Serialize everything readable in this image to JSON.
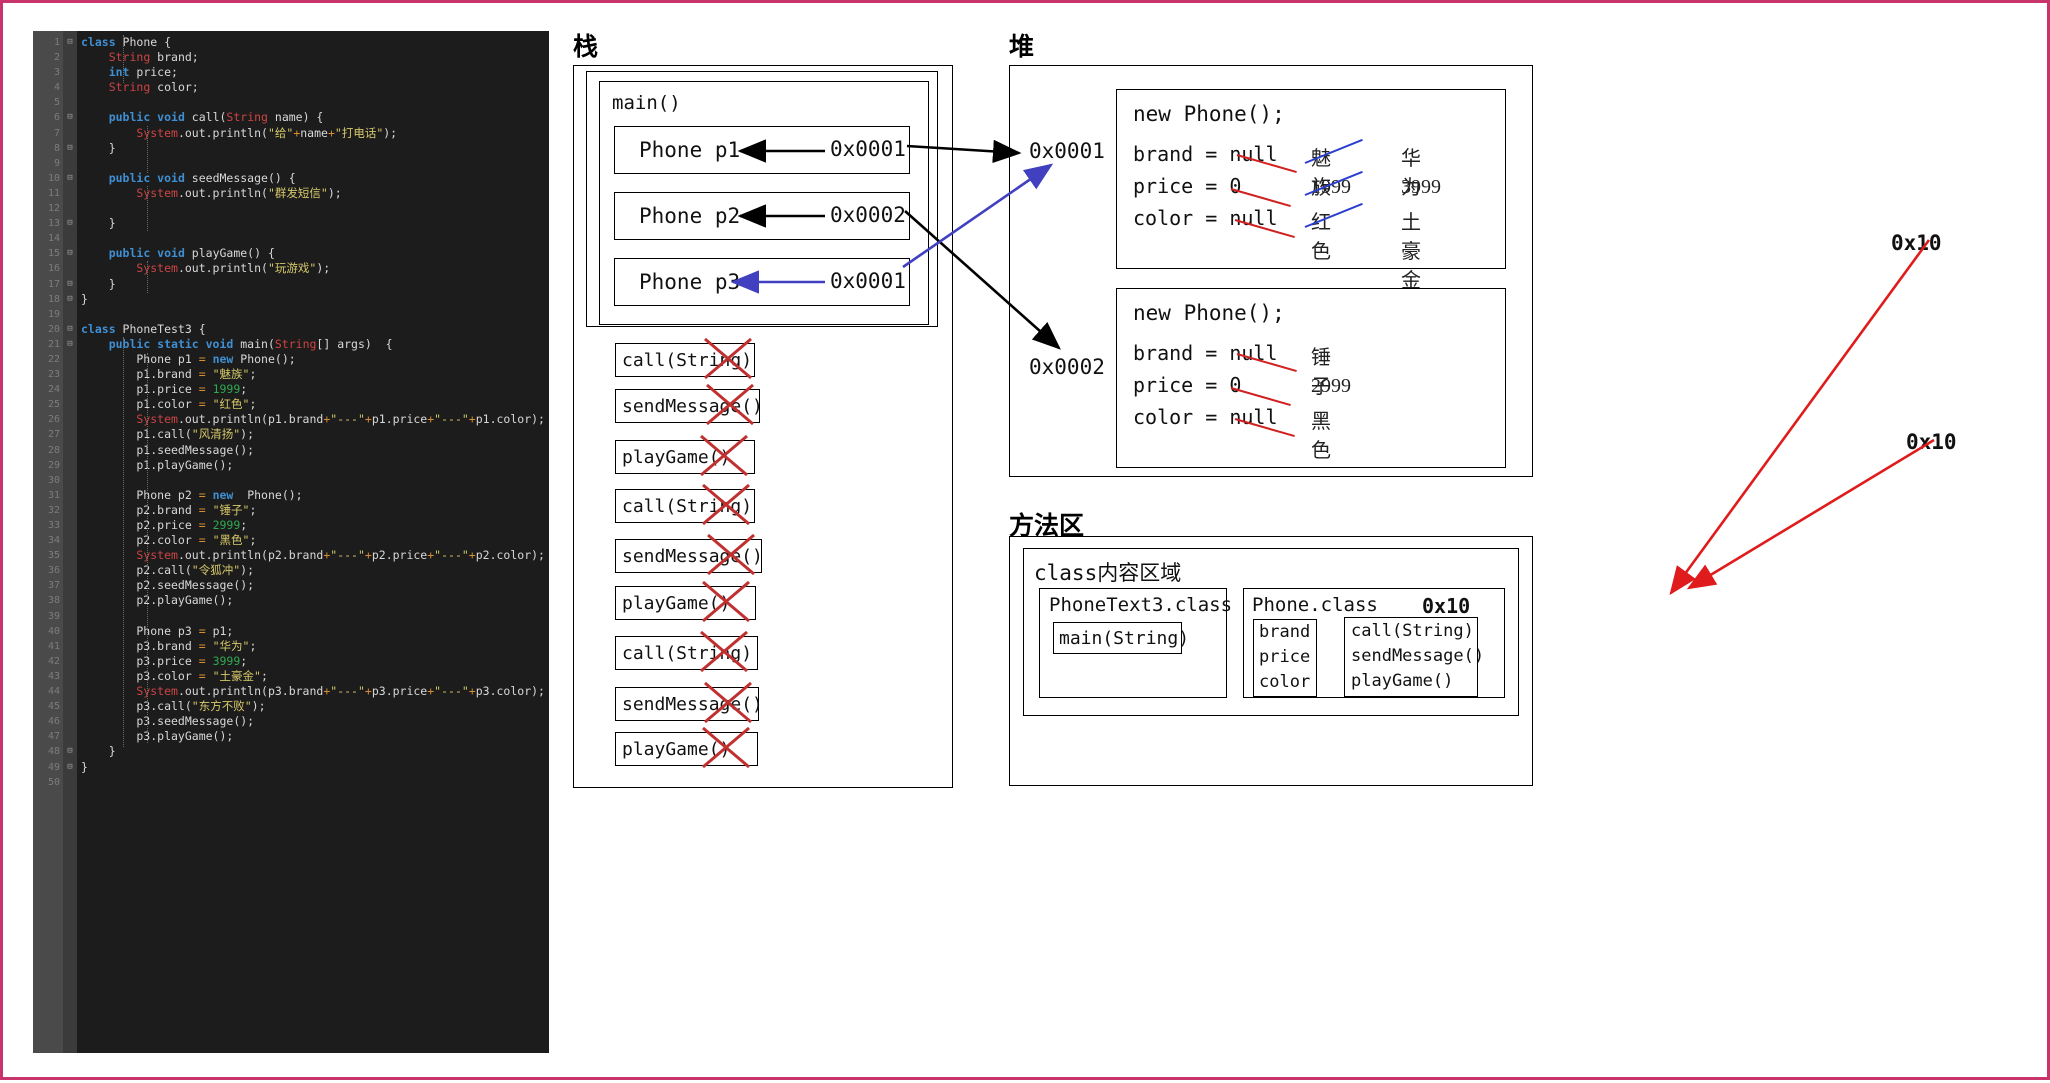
{
  "editor": {
    "name": "java-code-editor",
    "language": "Java",
    "total_lines": 50,
    "lines": [
      {
        "n": 1,
        "fold": "-",
        "tokens": [
          {
            "t": "class ",
            "c": "kw"
          },
          {
            "t": "Phone {",
            "c": "pl"
          }
        ]
      },
      {
        "n": 2,
        "fold": "",
        "tokens": [
          {
            "t": "    ",
            "c": "pl"
          },
          {
            "t": "String",
            "c": "ty"
          },
          {
            "t": " brand;",
            "c": "pl"
          }
        ]
      },
      {
        "n": 3,
        "fold": "",
        "tokens": [
          {
            "t": "    ",
            "c": "pl"
          },
          {
            "t": "int",
            "c": "kw"
          },
          {
            "t": " price;",
            "c": "pl"
          }
        ]
      },
      {
        "n": 4,
        "fold": "",
        "tokens": [
          {
            "t": "    ",
            "c": "pl"
          },
          {
            "t": "String",
            "c": "ty"
          },
          {
            "t": " color;",
            "c": "pl"
          }
        ]
      },
      {
        "n": 5,
        "fold": "",
        "tokens": []
      },
      {
        "n": 6,
        "fold": "-",
        "tokens": [
          {
            "t": "    ",
            "c": "pl"
          },
          {
            "t": "public void",
            "c": "kw"
          },
          {
            "t": " call(",
            "c": "pl"
          },
          {
            "t": "String",
            "c": "ty"
          },
          {
            "t": " name) {",
            "c": "pl"
          }
        ]
      },
      {
        "n": 7,
        "fold": "",
        "tokens": [
          {
            "t": "        ",
            "c": "pl"
          },
          {
            "t": "System",
            "c": "sysred"
          },
          {
            "t": ".out.println(",
            "c": "pl"
          },
          {
            "t": "\"给\"",
            "c": "st"
          },
          {
            "t": "+",
            "c": "op"
          },
          {
            "t": "name",
            "c": "pl"
          },
          {
            "t": "+",
            "c": "op"
          },
          {
            "t": "\"打电话\"",
            "c": "st"
          },
          {
            "t": ");",
            "c": "pl"
          }
        ]
      },
      {
        "n": 8,
        "fold": "-",
        "tokens": [
          {
            "t": "    }",
            "c": "pl"
          }
        ]
      },
      {
        "n": 9,
        "fold": "",
        "tokens": []
      },
      {
        "n": 10,
        "fold": "-",
        "tokens": [
          {
            "t": "    ",
            "c": "pl"
          },
          {
            "t": "public void",
            "c": "kw"
          },
          {
            "t": " seedMessage() {",
            "c": "pl"
          }
        ]
      },
      {
        "n": 11,
        "fold": "",
        "tokens": [
          {
            "t": "        ",
            "c": "pl"
          },
          {
            "t": "System",
            "c": "sysred"
          },
          {
            "t": ".out.println(",
            "c": "pl"
          },
          {
            "t": "\"群发短信\"",
            "c": "st"
          },
          {
            "t": ");",
            "c": "pl"
          }
        ]
      },
      {
        "n": 12,
        "fold": "",
        "tokens": []
      },
      {
        "n": 13,
        "fold": "-",
        "tokens": [
          {
            "t": "    }",
            "c": "pl"
          }
        ]
      },
      {
        "n": 14,
        "fold": "",
        "tokens": []
      },
      {
        "n": 15,
        "fold": "-",
        "tokens": [
          {
            "t": "    ",
            "c": "pl"
          },
          {
            "t": "public void",
            "c": "kw"
          },
          {
            "t": " playGame() {",
            "c": "pl"
          }
        ]
      },
      {
        "n": 16,
        "fold": "",
        "tokens": [
          {
            "t": "        ",
            "c": "pl"
          },
          {
            "t": "System",
            "c": "sysred"
          },
          {
            "t": ".out.println(",
            "c": "pl"
          },
          {
            "t": "\"玩游戏\"",
            "c": "st"
          },
          {
            "t": ");",
            "c": "pl"
          }
        ]
      },
      {
        "n": 17,
        "fold": "-",
        "tokens": [
          {
            "t": "    }",
            "c": "pl"
          }
        ]
      },
      {
        "n": 18,
        "fold": "-",
        "tokens": [
          {
            "t": "}",
            "c": "pl"
          }
        ]
      },
      {
        "n": 19,
        "fold": "",
        "tokens": []
      },
      {
        "n": 20,
        "fold": "-",
        "tokens": [
          {
            "t": "class ",
            "c": "kw"
          },
          {
            "t": "PhoneTest3 {",
            "c": "pl"
          }
        ]
      },
      {
        "n": 21,
        "fold": "-",
        "tokens": [
          {
            "t": "    ",
            "c": "pl"
          },
          {
            "t": "public static void",
            "c": "kw"
          },
          {
            "t": " main(",
            "c": "pl"
          },
          {
            "t": "String",
            "c": "ty"
          },
          {
            "t": "[] args)  {",
            "c": "pl"
          }
        ]
      },
      {
        "n": 22,
        "fold": "",
        "tokens": [
          {
            "t": "        Phone p1 ",
            "c": "pl"
          },
          {
            "t": "=",
            "c": "op"
          },
          {
            "t": " ",
            "c": "pl"
          },
          {
            "t": "new",
            "c": "kw"
          },
          {
            "t": " Phone();",
            "c": "pl"
          }
        ]
      },
      {
        "n": 23,
        "fold": "",
        "tokens": [
          {
            "t": "        p1.brand ",
            "c": "pl"
          },
          {
            "t": "=",
            "c": "op"
          },
          {
            "t": " ",
            "c": "pl"
          },
          {
            "t": "\"魅族\"",
            "c": "st"
          },
          {
            "t": ";",
            "c": "pl"
          }
        ]
      },
      {
        "n": 24,
        "fold": "",
        "tokens": [
          {
            "t": "        p1.price ",
            "c": "pl"
          },
          {
            "t": "=",
            "c": "op"
          },
          {
            "t": " ",
            "c": "pl"
          },
          {
            "t": "1999",
            "c": "nu"
          },
          {
            "t": ";",
            "c": "pl"
          }
        ]
      },
      {
        "n": 25,
        "fold": "",
        "tokens": [
          {
            "t": "        p1.color ",
            "c": "pl"
          },
          {
            "t": "=",
            "c": "op"
          },
          {
            "t": " ",
            "c": "pl"
          },
          {
            "t": "\"红色\"",
            "c": "st"
          },
          {
            "t": ";",
            "c": "pl"
          }
        ]
      },
      {
        "n": 26,
        "fold": "",
        "tokens": [
          {
            "t": "        ",
            "c": "pl"
          },
          {
            "t": "System",
            "c": "sysred"
          },
          {
            "t": ".out.println(p1.brand",
            "c": "pl"
          },
          {
            "t": "+",
            "c": "op"
          },
          {
            "t": "\"---\"",
            "c": "st"
          },
          {
            "t": "+",
            "c": "op"
          },
          {
            "t": "p1.price",
            "c": "pl"
          },
          {
            "t": "+",
            "c": "op"
          },
          {
            "t": "\"---\"",
            "c": "st"
          },
          {
            "t": "+",
            "c": "op"
          },
          {
            "t": "p1.color);",
            "c": "pl"
          }
        ]
      },
      {
        "n": 27,
        "fold": "",
        "tokens": [
          {
            "t": "        p1.call(",
            "c": "pl"
          },
          {
            "t": "\"风清扬\"",
            "c": "st"
          },
          {
            "t": ");",
            "c": "pl"
          }
        ]
      },
      {
        "n": 28,
        "fold": "",
        "tokens": [
          {
            "t": "        p1.seedMessage();",
            "c": "pl"
          }
        ]
      },
      {
        "n": 29,
        "fold": "",
        "tokens": [
          {
            "t": "        p1.playGame();",
            "c": "pl"
          }
        ]
      },
      {
        "n": 30,
        "fold": "",
        "tokens": []
      },
      {
        "n": 31,
        "fold": "",
        "tokens": [
          {
            "t": "        Phone p2 ",
            "c": "pl"
          },
          {
            "t": "=",
            "c": "op"
          },
          {
            "t": " ",
            "c": "pl"
          },
          {
            "t": "new",
            "c": "kw"
          },
          {
            "t": "  Phone();",
            "c": "pl"
          }
        ]
      },
      {
        "n": 32,
        "fold": "",
        "tokens": [
          {
            "t": "        p2.brand ",
            "c": "pl"
          },
          {
            "t": "=",
            "c": "op"
          },
          {
            "t": " ",
            "c": "pl"
          },
          {
            "t": "\"锤子\"",
            "c": "st"
          },
          {
            "t": ";",
            "c": "pl"
          }
        ]
      },
      {
        "n": 33,
        "fold": "",
        "tokens": [
          {
            "t": "        p2.price ",
            "c": "pl"
          },
          {
            "t": "=",
            "c": "op"
          },
          {
            "t": " ",
            "c": "pl"
          },
          {
            "t": "2999",
            "c": "nu"
          },
          {
            "t": ";",
            "c": "pl"
          }
        ]
      },
      {
        "n": 34,
        "fold": "",
        "tokens": [
          {
            "t": "        p2.color ",
            "c": "pl"
          },
          {
            "t": "=",
            "c": "op"
          },
          {
            "t": " ",
            "c": "pl"
          },
          {
            "t": "\"黑色\"",
            "c": "st"
          },
          {
            "t": ";",
            "c": "pl"
          }
        ]
      },
      {
        "n": 35,
        "fold": "",
        "tokens": [
          {
            "t": "        ",
            "c": "pl"
          },
          {
            "t": "System",
            "c": "sysred"
          },
          {
            "t": ".out.println(p2.brand",
            "c": "pl"
          },
          {
            "t": "+",
            "c": "op"
          },
          {
            "t": "\"---\"",
            "c": "st"
          },
          {
            "t": "+",
            "c": "op"
          },
          {
            "t": "p2.price",
            "c": "pl"
          },
          {
            "t": "+",
            "c": "op"
          },
          {
            "t": "\"---\"",
            "c": "st"
          },
          {
            "t": "+",
            "c": "op"
          },
          {
            "t": "p2.color);",
            "c": "pl"
          }
        ]
      },
      {
        "n": 36,
        "fold": "",
        "tokens": [
          {
            "t": "        p2.call(",
            "c": "pl"
          },
          {
            "t": "\"令狐冲\"",
            "c": "st"
          },
          {
            "t": ");",
            "c": "pl"
          }
        ]
      },
      {
        "n": 37,
        "fold": "",
        "tokens": [
          {
            "t": "        p2.seedMessage();",
            "c": "pl"
          }
        ]
      },
      {
        "n": 38,
        "fold": "",
        "tokens": [
          {
            "t": "        p2.playGame();",
            "c": "pl"
          }
        ]
      },
      {
        "n": 39,
        "fold": "",
        "tokens": []
      },
      {
        "n": 40,
        "fold": "",
        "tokens": [
          {
            "t": "        Phone p3 ",
            "c": "pl"
          },
          {
            "t": "=",
            "c": "op"
          },
          {
            "t": " p1;",
            "c": "pl"
          }
        ]
      },
      {
        "n": 41,
        "fold": "",
        "tokens": [
          {
            "t": "        p3.brand ",
            "c": "pl"
          },
          {
            "t": "=",
            "c": "op"
          },
          {
            "t": " ",
            "c": "pl"
          },
          {
            "t": "\"华为\"",
            "c": "st"
          },
          {
            "t": ";",
            "c": "pl"
          }
        ]
      },
      {
        "n": 42,
        "fold": "",
        "tokens": [
          {
            "t": "        p3.price ",
            "c": "pl"
          },
          {
            "t": "=",
            "c": "op"
          },
          {
            "t": " ",
            "c": "pl"
          },
          {
            "t": "3999",
            "c": "nu"
          },
          {
            "t": ";",
            "c": "pl"
          }
        ]
      },
      {
        "n": 43,
        "fold": "",
        "tokens": [
          {
            "t": "        p3.color ",
            "c": "pl"
          },
          {
            "t": "=",
            "c": "op"
          },
          {
            "t": " ",
            "c": "pl"
          },
          {
            "t": "\"土豪金\"",
            "c": "st"
          },
          {
            "t": ";",
            "c": "pl"
          }
        ]
      },
      {
        "n": 44,
        "fold": "",
        "tokens": [
          {
            "t": "        ",
            "c": "pl"
          },
          {
            "t": "System",
            "c": "sysred"
          },
          {
            "t": ".out.println(p3.brand",
            "c": "pl"
          },
          {
            "t": "+",
            "c": "op"
          },
          {
            "t": "\"---\"",
            "c": "st"
          },
          {
            "t": "+",
            "c": "op"
          },
          {
            "t": "p3.price",
            "c": "pl"
          },
          {
            "t": "+",
            "c": "op"
          },
          {
            "t": "\"---\"",
            "c": "st"
          },
          {
            "t": "+",
            "c": "op"
          },
          {
            "t": "p3.color);",
            "c": "pl"
          }
        ]
      },
      {
        "n": 45,
        "fold": "",
        "tokens": [
          {
            "t": "        p3.call(",
            "c": "pl"
          },
          {
            "t": "\"东方不败\"",
            "c": "st"
          },
          {
            "t": ");",
            "c": "pl"
          }
        ]
      },
      {
        "n": 46,
        "fold": "",
        "tokens": [
          {
            "t": "        p3.seedMessage();",
            "c": "pl"
          }
        ]
      },
      {
        "n": 47,
        "fold": "",
        "tokens": [
          {
            "t": "        p3.playGame();",
            "c": "pl"
          }
        ]
      },
      {
        "n": 48,
        "fold": "-",
        "tokens": [
          {
            "t": "    }",
            "c": "pl"
          }
        ]
      },
      {
        "n": 49,
        "fold": "-",
        "tokens": [
          {
            "t": "}",
            "c": "pl"
          }
        ]
      },
      {
        "n": 50,
        "fold": "",
        "tokens": []
      }
    ]
  },
  "stack": {
    "title": "栈",
    "frame_label": "main()",
    "variables": [
      {
        "label": "Phone p1",
        "address": "0x0001",
        "arrow_color": "#000000"
      },
      {
        "label": "Phone p2",
        "address": "0x0002",
        "arrow_color": "#000000"
      },
      {
        "label": "Phone p3",
        "address": "0x0001",
        "arrow_color": "#4040c0"
      }
    ],
    "method_calls": [
      {
        "label": "call(String)",
        "struck": true
      },
      {
        "label": "sendMessage()",
        "struck": true
      },
      {
        "label": "playGame()",
        "struck": true
      },
      {
        "label": "call(String)",
        "struck": true
      },
      {
        "label": "sendMessage()",
        "struck": true
      },
      {
        "label": "playGame()",
        "struck": true
      },
      {
        "label": "call(String)",
        "struck": true
      },
      {
        "label": "sendMessage()",
        "struck": true
      },
      {
        "label": "playGame()",
        "struck": true
      }
    ]
  },
  "heap": {
    "title": "堆",
    "addresses": [
      {
        "label": "0x0001"
      },
      {
        "label": "0x0002"
      }
    ],
    "objects": [
      {
        "header": "new Phone();",
        "fields": [
          {
            "name": "brand = ",
            "initial": "null",
            "initial_struck": "red",
            "v2": "魅族",
            "v2_struck": "blue",
            "v3": "华为"
          },
          {
            "name": "price = ",
            "initial": "0",
            "initial_struck": "red",
            "v2": "1999",
            "v2_struck": "blue",
            "v3": "3999"
          },
          {
            "name": "color = ",
            "initial": "null",
            "initial_struck": "red",
            "v2": "红色",
            "v2_struck": "blue",
            "v3": "土豪金"
          }
        ]
      },
      {
        "header": "new Phone();",
        "fields": [
          {
            "name": "brand = ",
            "initial": "null",
            "initial_struck": "red",
            "v2": "锤子",
            "v2_struck": "none",
            "v3": ""
          },
          {
            "name": "price = ",
            "initial": "0",
            "initial_struck": "red",
            "v2": "2999",
            "v2_struck": "none",
            "v3": ""
          },
          {
            "name": "color = ",
            "initial": "null",
            "initial_struck": "red",
            "v2": "黑色",
            "v2_struck": "none",
            "v3": ""
          }
        ]
      }
    ],
    "pointer_labels": [
      {
        "label": "0x10"
      },
      {
        "label": "0x10"
      }
    ]
  },
  "method_area": {
    "title": "方法区",
    "inner_title": "class内容区域",
    "classes": [
      {
        "name": "PhoneText3.class",
        "address": "",
        "fields": [],
        "methods": [
          "main(String)"
        ]
      },
      {
        "name": "Phone.class",
        "address": "0x10",
        "fields": [
          "brand",
          "price",
          "color"
        ],
        "methods": [
          "call(String)",
          "sendMessage()",
          "playGame()"
        ]
      }
    ]
  },
  "colors": {
    "page_border": "#c9336b",
    "editor_bg": "#1c1c1c",
    "gutter_bg": "#4a4a4a",
    "strike_red": "#d02020",
    "strike_blue": "#2a3fcf",
    "arrow_black": "#000000",
    "arrow_blue": "#4040c0",
    "arrow_red": "#e01b1b"
  }
}
